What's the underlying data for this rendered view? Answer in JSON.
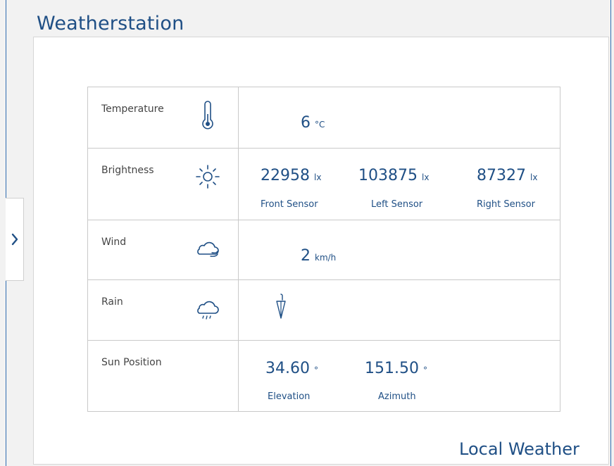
{
  "page": {
    "title": "Weatherstation",
    "footer": "Local Weather"
  },
  "colors": {
    "accent": "#1f4f85",
    "frame": "#2f6db0",
    "border": "#c9c9c9"
  },
  "nav": {
    "expand_icon": "chevron-right-icon"
  },
  "rows": {
    "temperature": {
      "label": "Temperature",
      "icon": "thermometer-icon",
      "value": "6",
      "unit": "°C"
    },
    "brightness": {
      "label": "Brightness",
      "icon": "sun-icon",
      "sensors": [
        {
          "value": "22958",
          "unit": "lx",
          "name": "Front Sensor"
        },
        {
          "value": "103875",
          "unit": "lx",
          "name": "Left Sensor"
        },
        {
          "value": "87327",
          "unit": "lx",
          "name": "Right Sensor"
        }
      ]
    },
    "wind": {
      "label": "Wind",
      "icon": "wind-cloud-icon",
      "value": "2",
      "unit": "km/h"
    },
    "rain": {
      "label": "Rain",
      "icon": "rain-cloud-icon",
      "status_icon": "umbrella-closed-icon"
    },
    "sun_position": {
      "label": "Sun Position",
      "elevation": {
        "value": "34.60",
        "unit": "°",
        "name": "Elevation"
      },
      "azimuth": {
        "value": "151.50",
        "unit": "°",
        "name": "Azimuth"
      }
    }
  }
}
